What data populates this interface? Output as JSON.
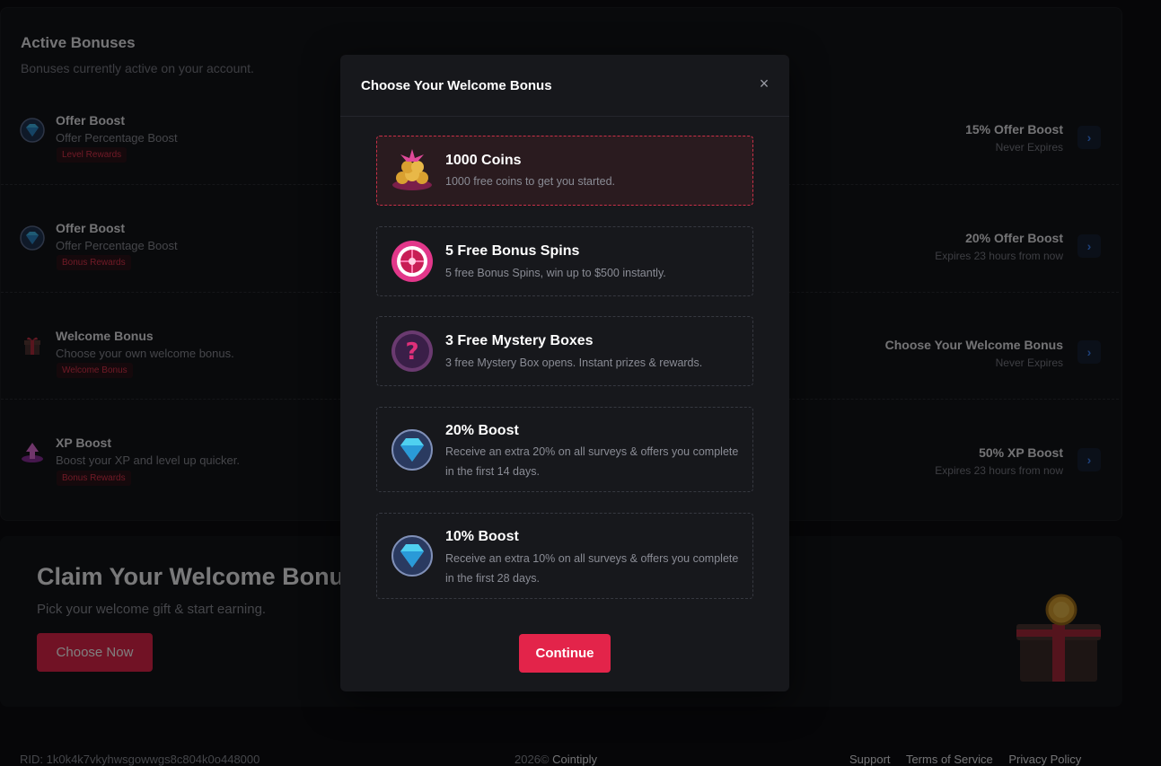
{
  "active_bonuses": {
    "title": "Active Bonuses",
    "subtitle": "Bonuses currently active on your account.",
    "rows": [
      {
        "icon": "diamond-icon",
        "name": "Offer Boost",
        "desc": "Offer Percentage Boost",
        "tag": "Level Rewards",
        "value": "15% Offer Boost",
        "expiry": "Never Expires"
      },
      {
        "icon": "diamond-icon",
        "name": "Offer Boost",
        "desc": "Offer Percentage Boost",
        "tag": "Bonus Rewards",
        "value": "20% Offer Boost",
        "expiry": "Expires 23 hours from now"
      },
      {
        "icon": "gift-box-icon",
        "name": "Welcome Bonus",
        "desc": "Choose your own welcome bonus.",
        "tag": "Welcome Bonus",
        "value": "Choose Your Welcome Bonus",
        "expiry": "Never Expires"
      },
      {
        "icon": "xp-arrow-icon",
        "name": "XP Boost",
        "desc": "Boost your XP and level up quicker.",
        "tag": "Bonus Rewards",
        "value": "50% XP Boost",
        "expiry": "Expires 23 hours from now"
      }
    ],
    "arrow": "›"
  },
  "claim": {
    "title": "Claim Your Welcome Bonus",
    "subtitle": "Pick your welcome gift & start earning.",
    "button": "Choose Now"
  },
  "footer": {
    "rid": "RID: 1k0k4k7vkyhwsgowwgs8c804k0o448000",
    "year": "2026©",
    "brand": "Cointiply",
    "links": [
      "Support",
      "Terms of Service",
      "Privacy Policy"
    ]
  },
  "modal": {
    "title": "Choose Your Welcome Bonus",
    "close": "×",
    "continue": "Continue",
    "selected_index": 0,
    "options": [
      {
        "icon": "coins-icon",
        "title": "1000 Coins",
        "desc": "1000 free coins to get you started."
      },
      {
        "icon": "spin-wheel-icon",
        "title": "5 Free Bonus Spins",
        "desc": "5 free Bonus Spins, win up to $500 instantly."
      },
      {
        "icon": "mystery-box-icon",
        "title": "3 Free Mystery Boxes",
        "desc": "3 free Mystery Box opens. Instant prizes & rewards."
      },
      {
        "icon": "diamond-icon",
        "title": "20% Boost",
        "desc": "Receive an extra 20% on all surveys & offers you complete in the first 14 days."
      },
      {
        "icon": "diamond-icon",
        "title": "10% Boost",
        "desc": "Receive an extra 10% on all surveys & offers you complete in the first 28 days."
      }
    ]
  },
  "colors": {
    "accent": "#e3244a",
    "tag_text": "#e0344d",
    "arrow": "#3b82f6"
  }
}
